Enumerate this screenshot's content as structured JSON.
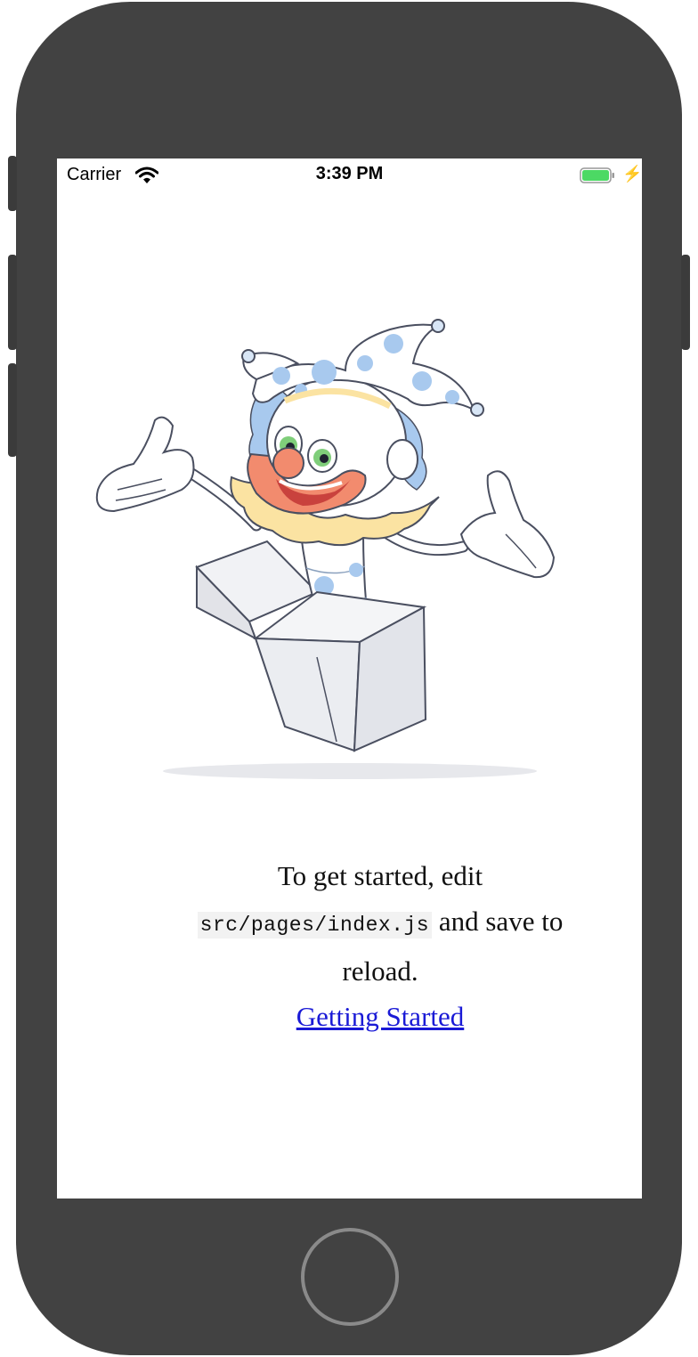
{
  "status_bar": {
    "carrier": "Carrier",
    "time": "3:39 PM",
    "battery_icon": "battery-charging-icon",
    "wifi_icon": "wifi-icon"
  },
  "content": {
    "illustration": "jester-jack-in-the-box",
    "line1": "To get started, edit",
    "code": "src/pages/index.js",
    "line2_suffix": " and save to",
    "line3": "reload.",
    "link_label": "Getting Started"
  },
  "colors": {
    "link": "#1a1ad6",
    "battery": "#4cd964",
    "device": "#424242"
  }
}
